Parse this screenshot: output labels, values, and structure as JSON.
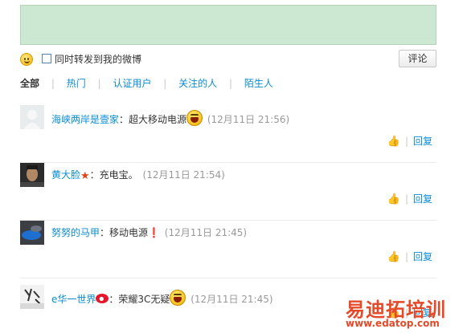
{
  "composer": {
    "repost_label": "同时转发到我的微博",
    "submit_label": "评论"
  },
  "filters": {
    "tabs": [
      "全部",
      "热门",
      "认证用户",
      "关注的人",
      "陌生人"
    ],
    "active": "全部"
  },
  "comments": [
    {
      "user": "海峡两岸是壹家",
      "text": "：超大移动电源",
      "time": "(12月11日 21:56)",
      "emoji": "laugh-icon"
    },
    {
      "user": "黄大脸",
      "text": "：充电宝。",
      "time": "(12月11日 21:54)",
      "badge": "vip-icon"
    },
    {
      "user": "努努的马甲",
      "text": "：移动电源❗",
      "time": "(12月11日 21:45)"
    },
    {
      "user": "e华一世界",
      "text": "：荣耀3C无疑",
      "time": "(12月11日 21:45)",
      "badge": "weibo-icon",
      "emoji": "laugh-icon"
    }
  ],
  "actions": {
    "reply_label": "回复"
  },
  "watermark": {
    "title": "易迪拓培训",
    "url": "www.edatop.com"
  }
}
